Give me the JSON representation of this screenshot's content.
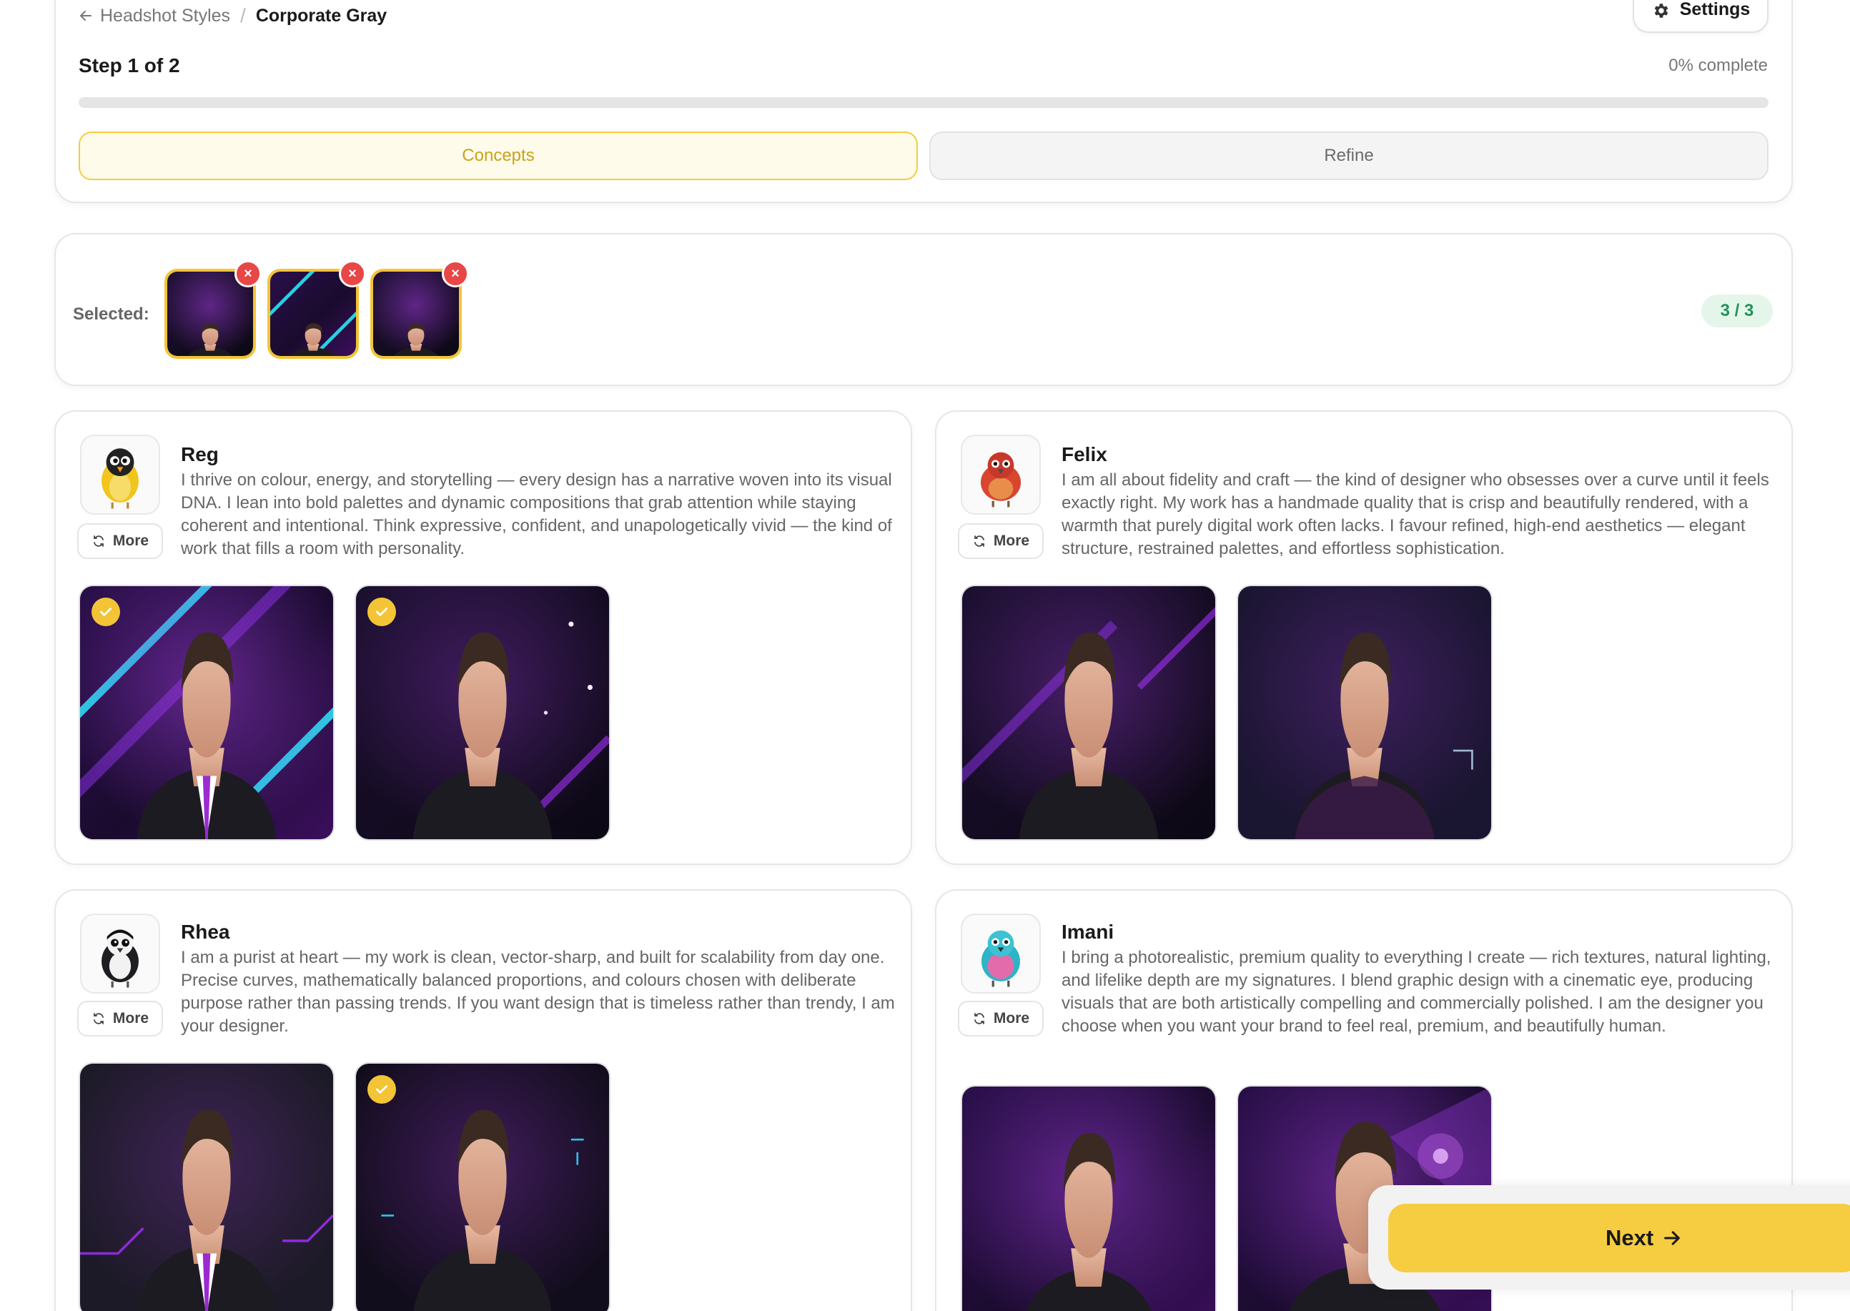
{
  "breadcrumb": {
    "back_label": "Headshot Styles",
    "separator": "/",
    "current": "Corporate Gray"
  },
  "header": {
    "settings_label": "Settings",
    "step_label": "Step 1 of 2",
    "progress_text": "0% complete",
    "progress_fraction": 0.0
  },
  "tabs": [
    {
      "label": "Concepts",
      "active": true
    },
    {
      "label": "Refine",
      "active": false
    }
  ],
  "selection": {
    "label": "Selected:",
    "count_text": "3 / 3",
    "remove_symbol": "×"
  },
  "designers": [
    {
      "name": "Reg",
      "more_label": "More",
      "avatar_icon": "yellow-bird-icon",
      "description": "I thrive on colour, energy, and storytelling — every design has a narrative woven into its visual DNA. I lean into bold palettes and dynamic compositions that grab attention while staying coherent and intentional. Think expressive, confident, and unapologetically vivid — the kind of work that fills a room with personality.",
      "photos": [
        {
          "selected": true
        },
        {
          "selected": true
        }
      ]
    },
    {
      "name": "Felix",
      "more_label": "More",
      "avatar_icon": "red-bird-icon",
      "description": "I am all about fidelity and craft — the kind of designer who obsesses over a curve until it feels exactly right. My work has a handmade quality that is crisp and beautifully rendered, with a warmth that purely digital work often lacks. I favour refined, high-end aesthetics — elegant structure, restrained palettes, and effortless sophistication.",
      "photos": [
        {
          "selected": false
        },
        {
          "selected": false
        }
      ]
    },
    {
      "name": "Rhea",
      "more_label": "More",
      "avatar_icon": "magpie-bird-icon",
      "description": "I am a purist at heart — my work is clean, vector-sharp, and built for scalability from day one. Precise curves, mathematically balanced proportions, and colours chosen with deliberate purpose rather than passing trends. If you want design that is timeless rather than trendy, I am your designer.",
      "photos": [
        {
          "selected": false
        },
        {
          "selected": true
        }
      ]
    },
    {
      "name": "Imani",
      "more_label": "More",
      "avatar_icon": "teal-pink-bird-icon",
      "description": "I bring a photorealistic, premium quality to everything I create — rich textures, natural lighting, and lifelike depth are my signatures. I blend graphic design with a cinematic eye, producing visuals that are both artistically compelling and commercially polished. I am the designer you choose when you want your brand to feel real, premium, and beautifully human.",
      "photos": [
        {
          "selected": false
        },
        {
          "selected": false
        }
      ]
    }
  ],
  "footer": {
    "next_label": "Next"
  },
  "colors": {
    "accent": "#f6cd40",
    "remove": "#e94646",
    "badge_text": "#25925a",
    "badge_bg": "#e4f6ea"
  }
}
